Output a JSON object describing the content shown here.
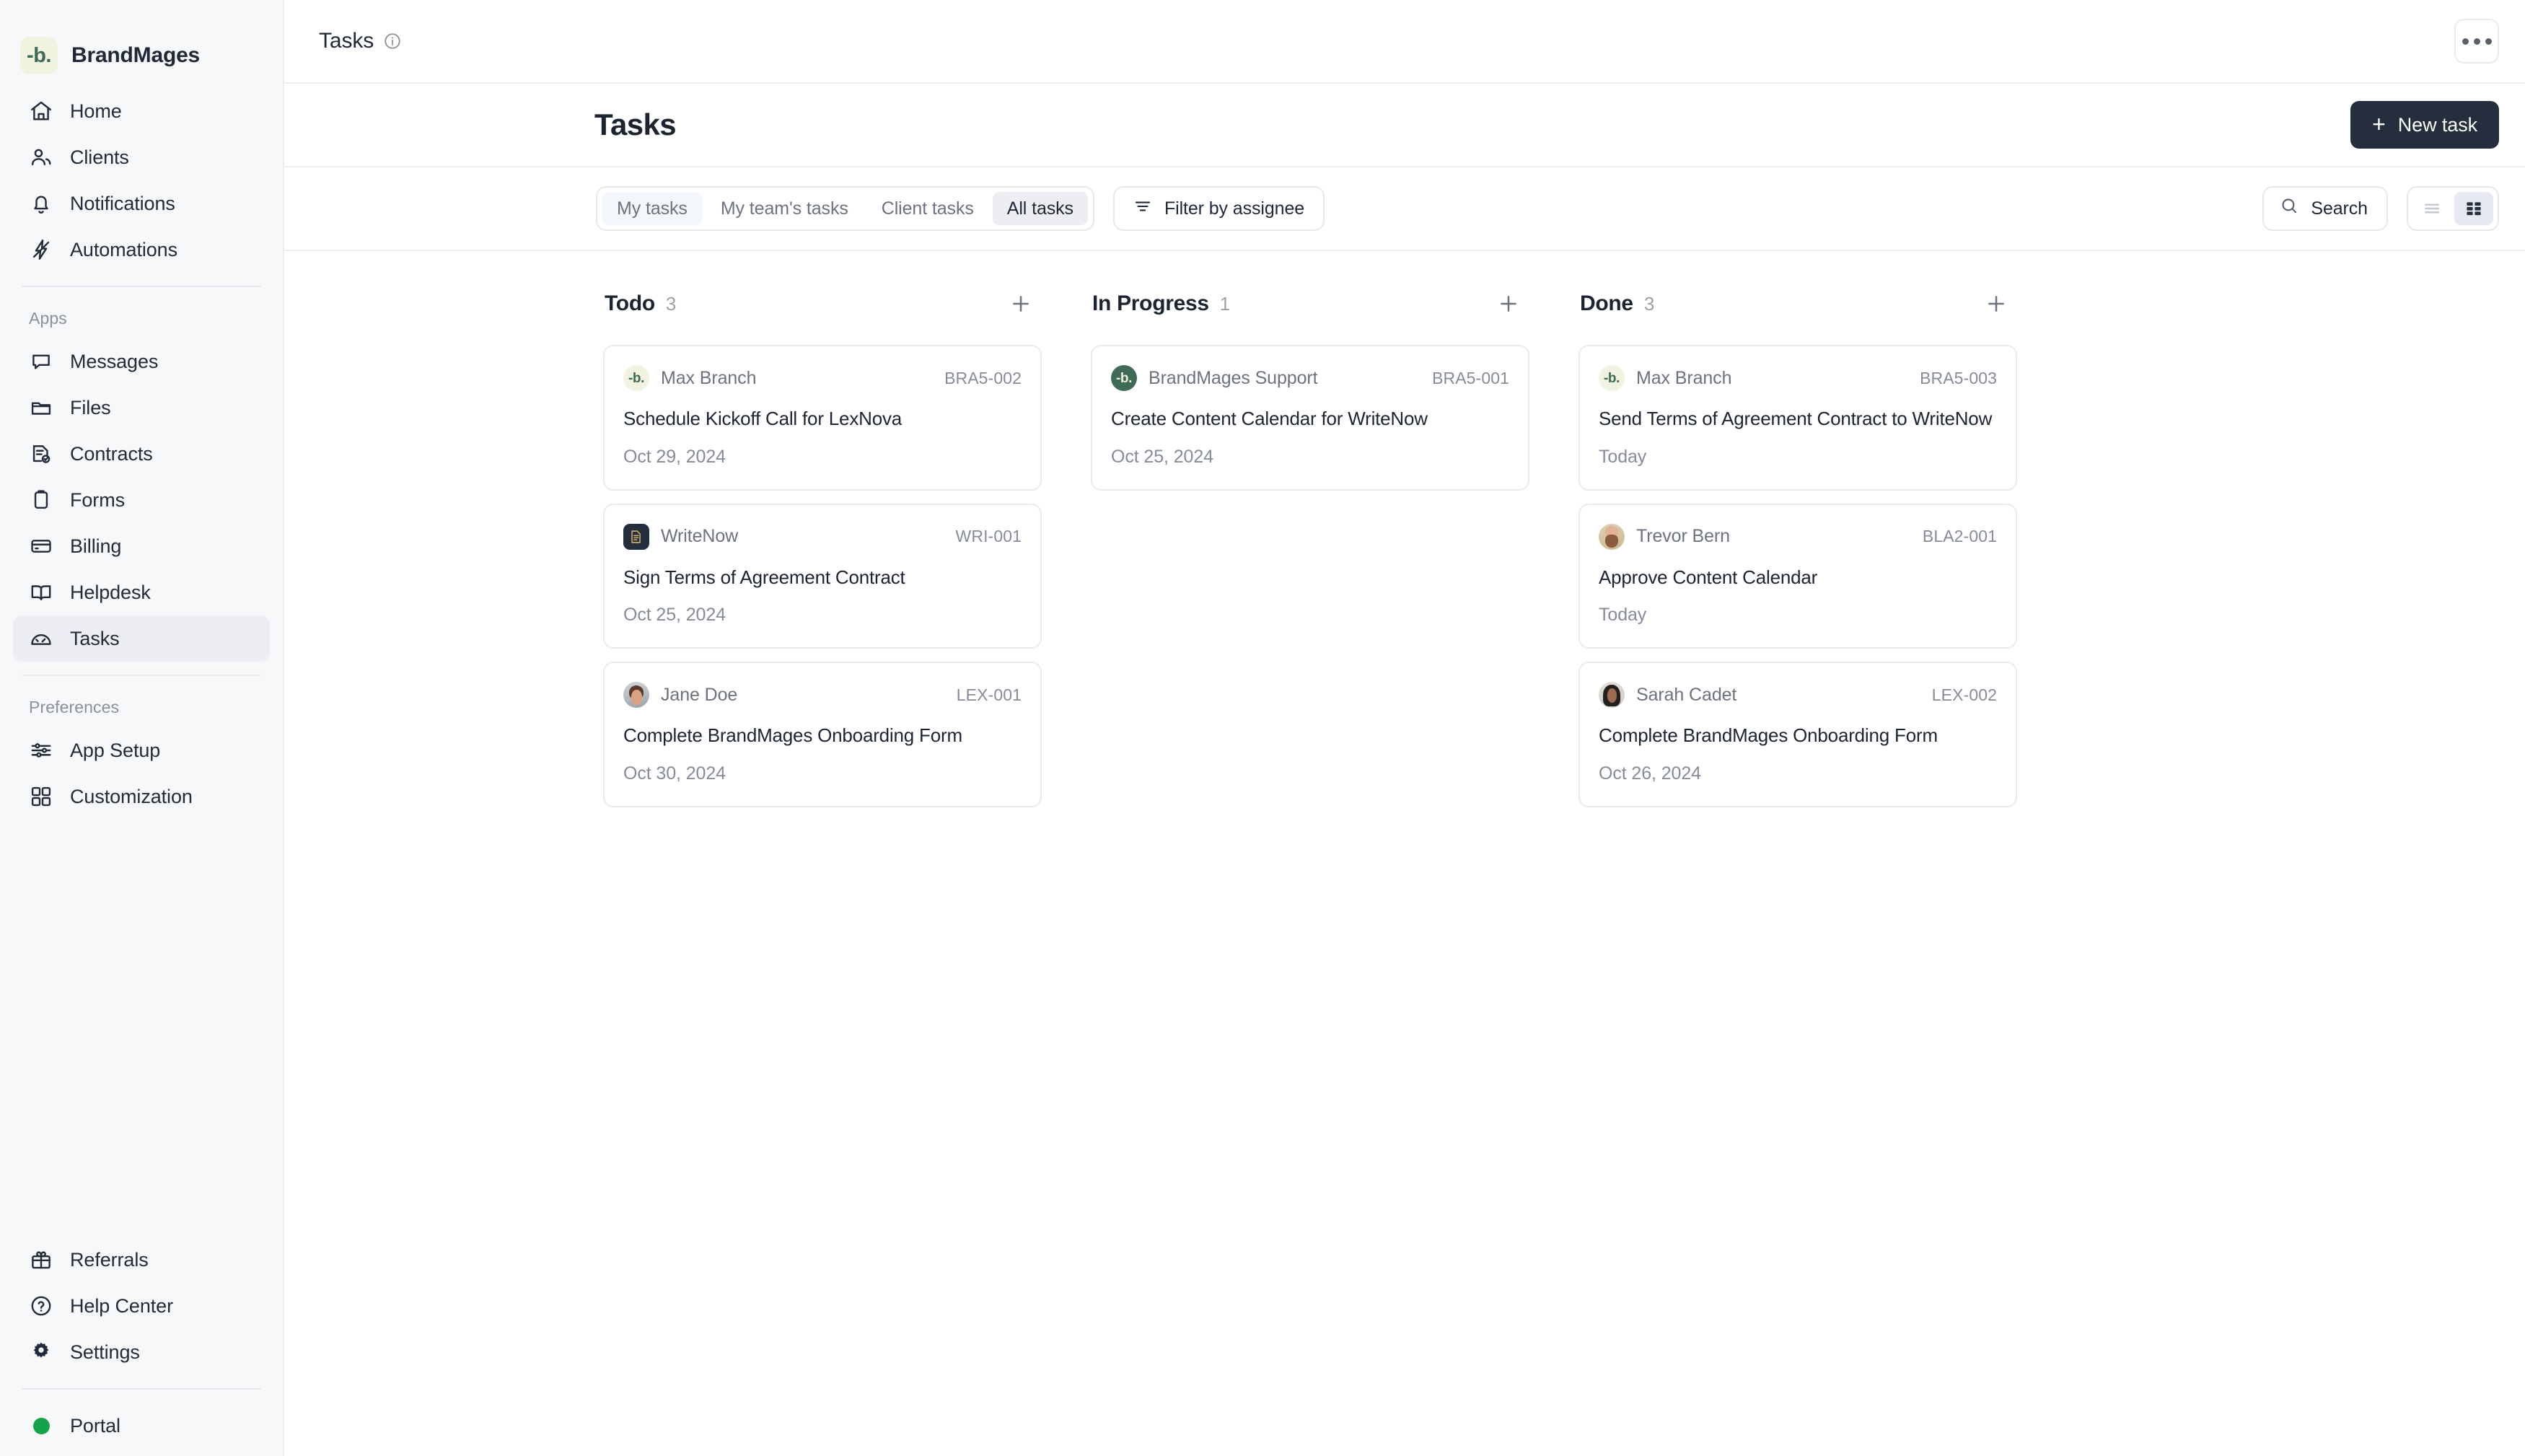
{
  "sidebar": {
    "brand": {
      "logo_text": "-b.",
      "name": "BrandMages"
    },
    "main_items": [
      {
        "label": "Home",
        "icon": "home-icon"
      },
      {
        "label": "Clients",
        "icon": "users-icon"
      },
      {
        "label": "Notifications",
        "icon": "bell-icon"
      },
      {
        "label": "Automations",
        "icon": "lightning-icon"
      }
    ],
    "apps_section_title": "Apps",
    "apps_items": [
      {
        "label": "Messages",
        "icon": "chat-icon"
      },
      {
        "label": "Files",
        "icon": "folder-icon"
      },
      {
        "label": "Contracts",
        "icon": "contract-icon"
      },
      {
        "label": "Forms",
        "icon": "clipboard-icon"
      },
      {
        "label": "Billing",
        "icon": "card-icon"
      },
      {
        "label": "Helpdesk",
        "icon": "book-icon"
      },
      {
        "label": "Tasks",
        "icon": "tasks-icon",
        "active": true
      }
    ],
    "preferences_section_title": "Preferences",
    "preferences_items": [
      {
        "label": "App Setup",
        "icon": "sliders-icon"
      },
      {
        "label": "Customization",
        "icon": "grid-icon"
      }
    ],
    "bottom_items": [
      {
        "label": "Referrals",
        "icon": "gift-icon"
      },
      {
        "label": "Help Center",
        "icon": "question-circle-icon"
      },
      {
        "label": "Settings",
        "icon": "gear-icon"
      }
    ],
    "portal": {
      "label": "Portal",
      "icon": "green-dot-icon",
      "dot_color": "#15a34a"
    }
  },
  "topbar": {
    "title": "Tasks",
    "info_icon": "info-icon",
    "kebab_label": "more-options"
  },
  "pagehead": {
    "title": "Tasks",
    "new_task_label": "New task",
    "new_task_plus": "+"
  },
  "toolbar": {
    "tabs": [
      {
        "label": "My tasks",
        "state": "hover"
      },
      {
        "label": "My team's tasks",
        "state": "idle"
      },
      {
        "label": "Client tasks",
        "state": "idle"
      },
      {
        "label": "All tasks",
        "state": "active"
      }
    ],
    "filter_label": "Filter by assignee",
    "filter_icon": "filter-icon",
    "search_label": "Search",
    "search_icon": "search-icon",
    "view_list_icon": "list-view-icon",
    "view_grid_icon": "grid-view-icon",
    "active_view": "grid"
  },
  "board": {
    "columns": [
      {
        "name": "Todo",
        "count": "3",
        "add_icon": "plus-icon",
        "cards": [
          {
            "person": "Max Branch",
            "avatar": "brand-logo-cream-avatar",
            "avatar_text": "-b.",
            "code": "BRA5-002",
            "title": "Schedule Kickoff Call for LexNova",
            "date": "Oct 29, 2024"
          },
          {
            "person": "WriteNow",
            "avatar": "writenow-document-avatar",
            "avatar_text": "",
            "code": "WRI-001",
            "title": "Sign Terms of Agreement Contract",
            "date": "Oct 25, 2024"
          },
          {
            "person": "Jane Doe",
            "avatar": "jane-doe-photo-avatar",
            "avatar_text": "",
            "code": "LEX-001",
            "title": "Complete BrandMages Onboarding Form",
            "date": "Oct 30, 2024"
          }
        ]
      },
      {
        "name": "In Progress",
        "count": "1",
        "add_icon": "plus-icon",
        "cards": [
          {
            "person": "BrandMages Support",
            "avatar": "brand-logo-green-avatar",
            "avatar_text": "-b.",
            "code": "BRA5-001",
            "title": "Create Content Calendar for WriteNow",
            "date": "Oct 25, 2024"
          }
        ]
      },
      {
        "name": "Done",
        "count": "3",
        "add_icon": "plus-icon",
        "cards": [
          {
            "person": "Max Branch",
            "avatar": "brand-logo-cream-avatar",
            "avatar_text": "-b.",
            "code": "BRA5-003",
            "title": "Send Terms of Agreement Contract to WriteNow",
            "date": "Today"
          },
          {
            "person": "Trevor Bern",
            "avatar": "trevor-bern-photo-avatar",
            "avatar_text": "",
            "code": "BLA2-001",
            "title": "Approve Content Calendar",
            "date": "Today"
          },
          {
            "person": "Sarah Cadet",
            "avatar": "sarah-cadet-photo-avatar",
            "avatar_text": "",
            "code": "LEX-002",
            "title": "Complete BrandMages Onboarding Form",
            "date": "Oct 26, 2024"
          }
        ]
      }
    ]
  },
  "colors": {
    "accent_dark": "#242e3d",
    "brand_green": "#3f6b56",
    "brand_cream": "#f1f2df",
    "portal_green": "#15a34a",
    "active_tab_bg": "#eceef2"
  }
}
